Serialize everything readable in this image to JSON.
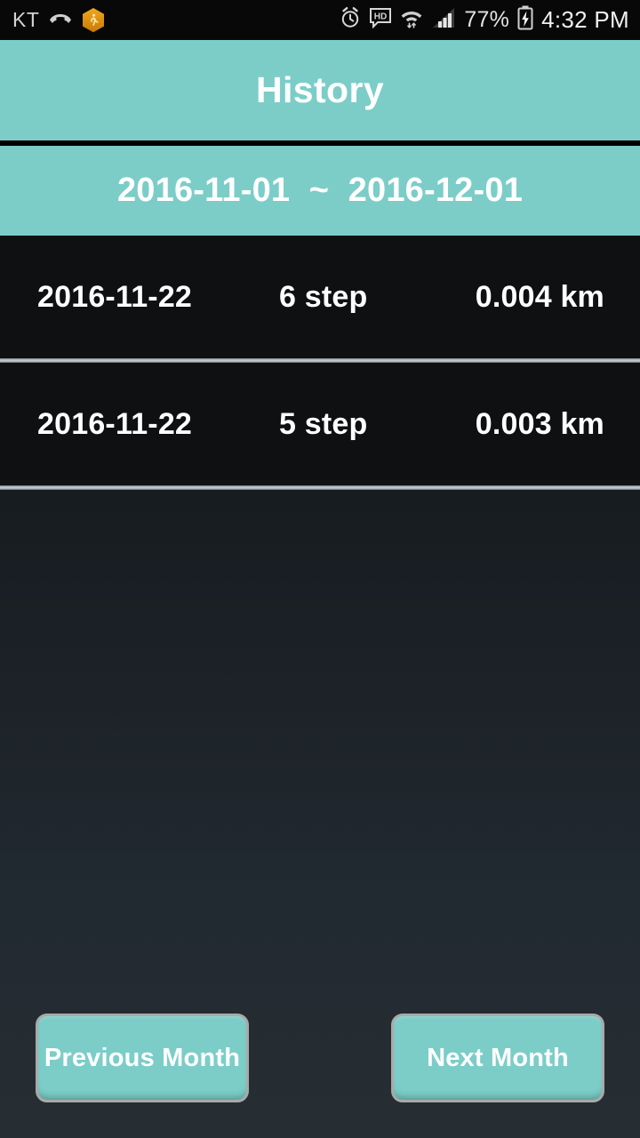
{
  "status_bar": {
    "carrier": "KT",
    "icons_left": [
      "missed-call-icon",
      "health-hexagon-badge-icon"
    ],
    "icons_right": [
      "alarm-clock-icon",
      "hd-voice-icon",
      "wifi-icon",
      "cellular-signal-icon"
    ],
    "battery_percent": "77%",
    "battery_state": "charging",
    "time": "4:32 PM"
  },
  "header": {
    "title": "History"
  },
  "date_range": {
    "start": "2016-11-01",
    "separator": "~",
    "end": "2016-12-01",
    "display": "2016-11-01  ~  2016-12-01"
  },
  "history_list": {
    "columns": [
      "date",
      "steps",
      "distance"
    ],
    "rows": [
      {
        "date": "2016-11-22",
        "steps": "6 step",
        "distance": "0.004 km"
      },
      {
        "date": "2016-11-22",
        "steps": "5 step",
        "distance": "0.003 km"
      }
    ]
  },
  "footer": {
    "previous_button": "Previous Month",
    "next_button": "Next Month"
  },
  "colors": {
    "accent_teal": "#7ccdc8",
    "row_background": "#0e1012",
    "page_background_top": "#0c0e10",
    "page_background_bottom": "#272e33",
    "text_white": "#ffffff",
    "separator": "#c9cfd4"
  }
}
